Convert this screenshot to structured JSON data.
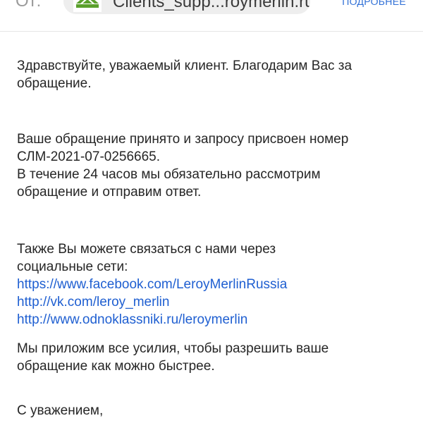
{
  "header": {
    "from_label": "От:",
    "sender": "Clients_supp...roymerlin.ru",
    "details_link": "ПОДРОБНЕЕ"
  },
  "email": {
    "greeting": [
      "Здравствуйте, уважаемый клиент. Благодарим Вас за",
      "обращение."
    ],
    "request_info": [
      "Ваше обращение принято и запросу присвоен номер",
      "СЛМ-2021-07-0256665.",
      "В течение 24 часов мы обязательно рассмотрим",
      "обращение и отправим ответ."
    ],
    "social_intro": [
      "Также Вы можете связаться с нами через",
      "социальные сети:"
    ],
    "social_links": [
      "https://www.facebook.com/LeroyMerlinRussia",
      "http://vk.com/leroy_merlin",
      "http://www.odnoklassniki.ru/leroymerlin"
    ],
    "effort": [
      "Мы приложим все усилия, чтобы разрешить ваше",
      "обращение как можно быстрее."
    ],
    "sign_off": "С уважением,"
  },
  "colors": {
    "link": "#1f5fd1",
    "details_link": "#2f6fd6",
    "text": "#262626",
    "muted": "#9a9a9a",
    "chip": "#eeeeee",
    "logo_green": "#5aa02c"
  }
}
